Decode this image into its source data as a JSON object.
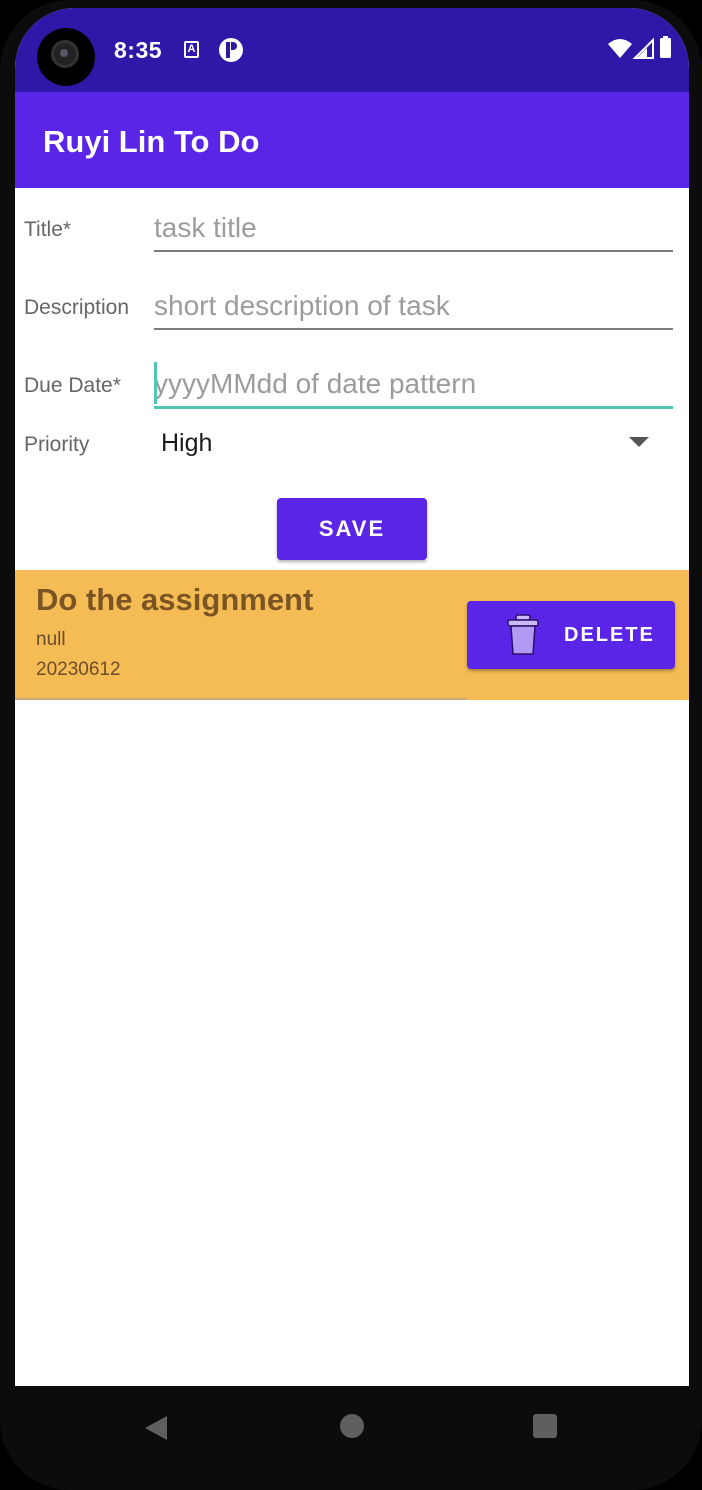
{
  "status_bar": {
    "time": "8:35",
    "icons": [
      "camera-cutout",
      "a-notification-icon",
      "p-notification-icon",
      "wifi-icon",
      "signal-icon",
      "battery-icon"
    ]
  },
  "app_bar": {
    "title": "Ruyi Lin To Do"
  },
  "form": {
    "title_label": "Title*",
    "title_placeholder": "task title",
    "title_value": "",
    "description_label": "Description",
    "description_placeholder": "short description of task",
    "description_value": "",
    "due_date_label": "Due Date*",
    "due_date_placeholder": "yyyyMMdd of date pattern",
    "due_date_value": "",
    "priority_label": "Priority",
    "priority_selected": "High",
    "save_label": "SAVE"
  },
  "tasks": [
    {
      "title": "Do the assignment",
      "description": "null",
      "due_date": "20230612",
      "delete_label": "DELETE"
    }
  ],
  "colors": {
    "status_bar": "#2f18a8",
    "app_bar": "#5a25e6",
    "accent": "#52c6b3",
    "task_row_high": "#f5bb54",
    "button": "#5a25e6"
  },
  "nav_bar": {
    "icons": [
      "back-icon",
      "home-icon",
      "recents-icon"
    ]
  }
}
